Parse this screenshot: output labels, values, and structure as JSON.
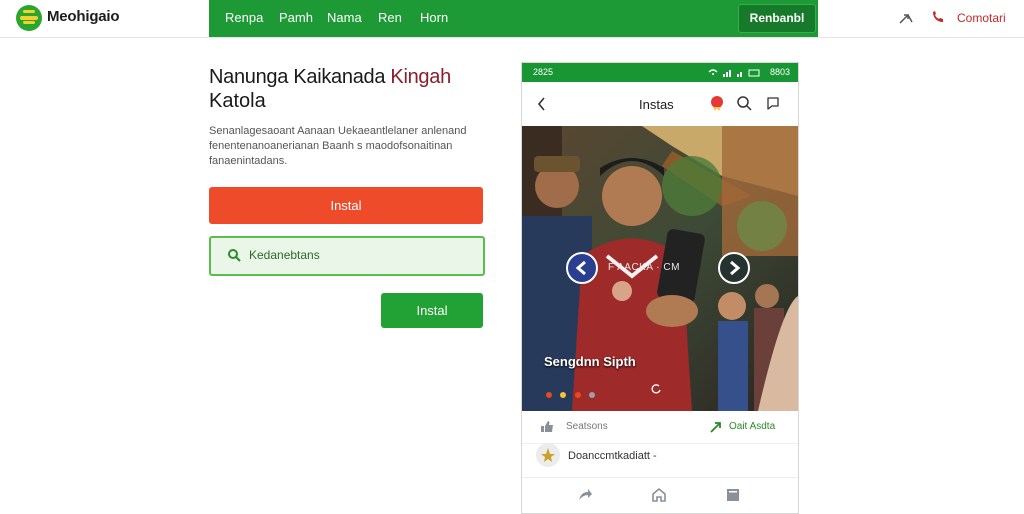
{
  "brand": {
    "name": "Meohigaio",
    "sub": "  "
  },
  "nav": {
    "items": [
      "Renpa",
      "Pamh",
      "Nama",
      "Ren",
      "Horn"
    ],
    "button_label": "Renbanbl"
  },
  "header_right": {
    "contact_label": "Comotari"
  },
  "hero": {
    "title_line1": "Nanunga Kaikanada ",
    "title_accent": "Kingah",
    "title_line2": "Katola",
    "paragraph_lines": [
      "Senanlagesaoant Aanaan Uekaeantlelaner anlenand",
      "fenentenanoanerianan Baanh s maodofsonaitinan",
      "fanaenintadans."
    ]
  },
  "buttons": {
    "install_primary": "Instal",
    "search_value": "Kedanebtans",
    "install_secondary": "Instal"
  },
  "phone": {
    "status_time": "2825",
    "status_right": "8803",
    "app_title": "Instas",
    "photo_overlay_text": "F AACKA · CM",
    "caption": "Sengdnn Sipth",
    "dot_colors": [
      "#e64a19",
      "#f9c23c",
      "#e64a19",
      "#9aa0a6"
    ],
    "like_label": "Seatsons",
    "share_label": "Oait Asdta",
    "row2_label": "Doanccmtkadiatt -"
  },
  "colors": {
    "primary_green": "#1d9a35",
    "accent_red": "#ee4b2b",
    "contact_red": "#c62828"
  },
  "icons": [
    "logo-icon",
    "share-icon",
    "contact-icon",
    "search-icon",
    "back-icon",
    "badge-icon",
    "chat-icon",
    "arrow-left-icon",
    "arrow-right-icon",
    "like-icon",
    "share-arrow-icon",
    "star-icon",
    "nav-share-icon",
    "nav-home-icon",
    "nav-menu-icon"
  ]
}
